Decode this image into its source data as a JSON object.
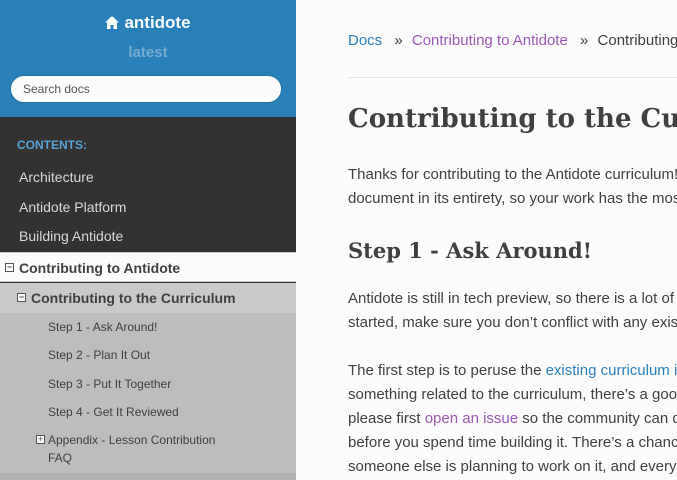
{
  "sidebar": {
    "project_name": "antidote",
    "version": "latest",
    "search_placeholder": "Search docs",
    "caption": "CONTENTS:",
    "items": [
      {
        "label": "Architecture"
      },
      {
        "label": "Antidote Platform"
      },
      {
        "label": "Building Antidote"
      }
    ],
    "current": {
      "label": "Contributing to Antidote",
      "toggle": "−"
    },
    "current_sub": {
      "label": "Contributing to the Curriculum",
      "toggle": "−"
    },
    "sub_items": [
      {
        "label": "Step 1 - Ask Around!"
      },
      {
        "label": "Step 2 - Plan It Out"
      },
      {
        "label": "Step 3 - Put It Together"
      },
      {
        "label": "Step 4 - Get It Reviewed"
      }
    ],
    "appendix": {
      "line1": "Appendix - Lesson Contribution",
      "line2": "FAQ",
      "toggle": "+"
    }
  },
  "breadcrumbs": {
    "docs": "Docs",
    "sep": "»",
    "parent": "Contributing to Antidote",
    "current": "Contributing to the Curriculum"
  },
  "content": {
    "title": "Contributing to the Curriculum",
    "intro": [
      "Thanks for contributing to the Antidote curriculum! Please read this",
      "document in its entirety, so your work has the most impact."
    ],
    "step1_heading": "Step 1 - Ask Around!",
    "step1_p1": [
      "Antidote is still in tech preview, so there is a lot of work to do. Before you get",
      "started, make sure you don’t conflict with any existing efforts."
    ],
    "step1_p2": {
      "line1_pre": "The first step is to peruse the ",
      "line1_link": "existing curriculum issues",
      "line2": "something related to the curriculum, there’s a good chance it’s already tracked,",
      "line3_pre": "please first ",
      "line3_link": "open an issue",
      "line3_post": " so the community can discuss and weigh in on the idea",
      "line4": "before you spend time building it. There’s a chance that",
      "line5": "someone else is planning to work on it, and every effort should be coordinated."
    }
  },
  "colors": {
    "sidebar_bg": "#343131",
    "header_bg": "#2980b9",
    "link": "#2980b9",
    "visited_link": "#9b59b6",
    "text": "#404040"
  }
}
